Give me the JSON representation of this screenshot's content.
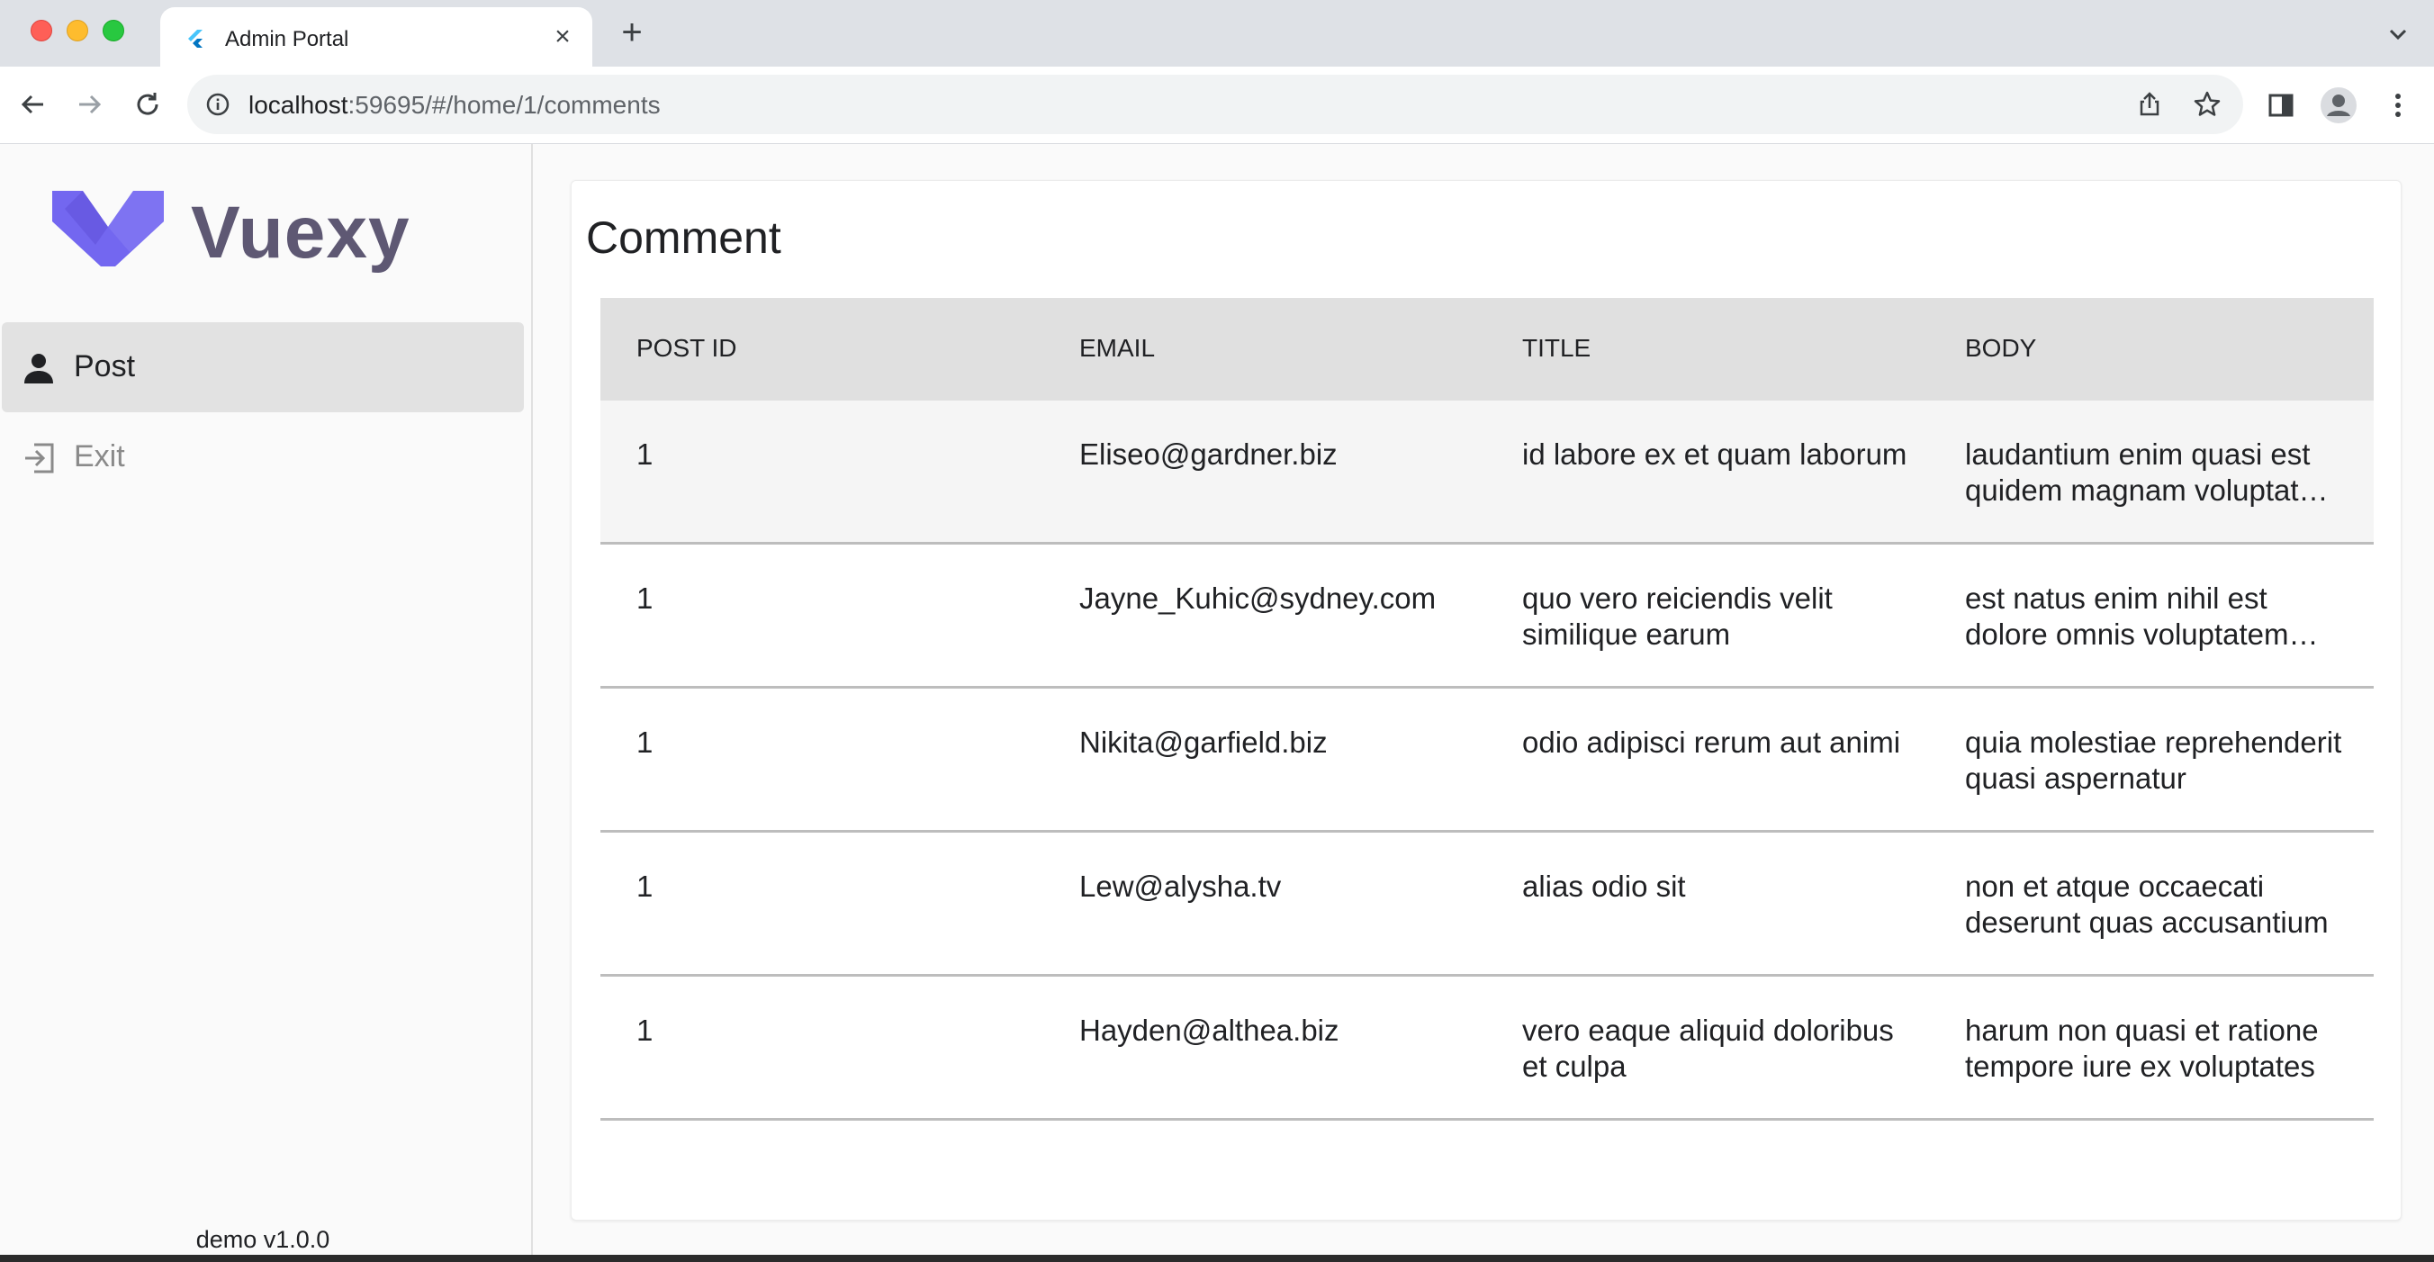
{
  "browser": {
    "tab_title": "Admin Portal",
    "url_host": "localhost",
    "url_rest": ":59695/#/home/1/comments"
  },
  "sidebar": {
    "brand": "Vuexy",
    "brand_color": "#7367f0",
    "items": [
      {
        "label": "Post",
        "icon": "person-icon",
        "active": true
      },
      {
        "label": "Exit",
        "icon": "exit-icon",
        "active": false
      }
    ],
    "version": "demo v1.0.0"
  },
  "main": {
    "title": "Comment",
    "columns": [
      "POST ID",
      "EMAIL",
      "TITLE",
      "BODY"
    ],
    "rows": [
      {
        "post_id": "1",
        "email": "Eliseo@gardner.biz",
        "title": "id labore ex et quam laborum",
        "body": "laudantium enim quasi est quidem magnam voluptate ipsam eos"
      },
      {
        "post_id": "1",
        "email": "Jayne_Kuhic@sydney.com",
        "title": "quo vero reiciendis velit similique earum",
        "body": "est natus enim nihil est dolore omnis voluptatem numquam"
      },
      {
        "post_id": "1",
        "email": "Nikita@garfield.biz",
        "title": "odio adipisci rerum aut animi",
        "body": "quia molestiae reprehenderit quasi aspernatur"
      },
      {
        "post_id": "1",
        "email": "Lew@alysha.tv",
        "title": "alias odio sit",
        "body": "non et atque occaecati deserunt quas accusantium"
      },
      {
        "post_id": "1",
        "email": "Hayden@althea.biz",
        "title": "vero eaque aliquid doloribus et culpa",
        "body": "harum non quasi et ratione tempore iure ex voluptates"
      }
    ]
  }
}
